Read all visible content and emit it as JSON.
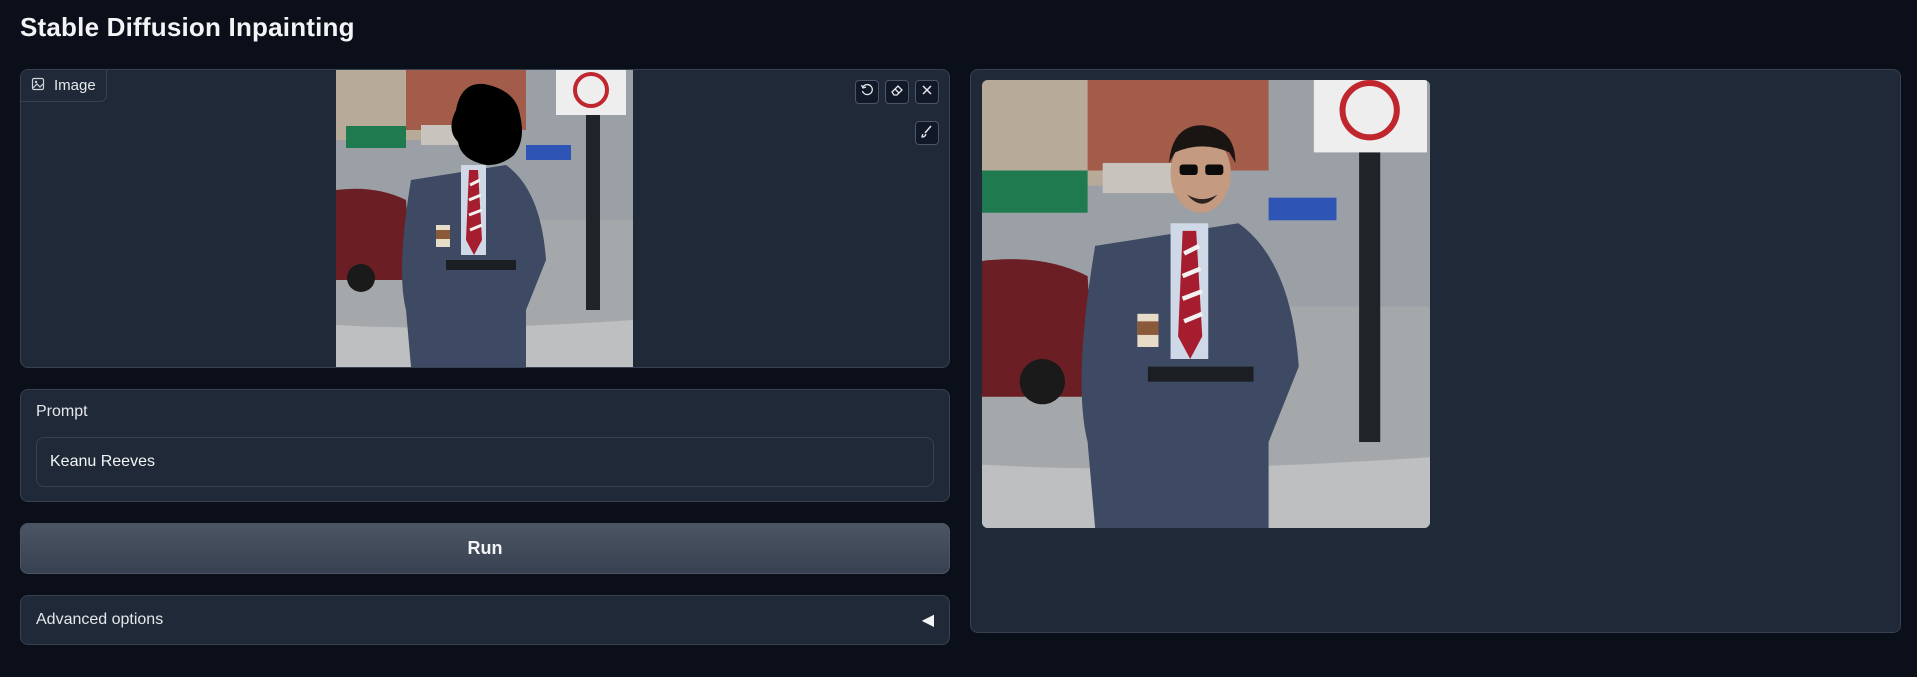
{
  "app": {
    "title": "Stable Diffusion Inpainting"
  },
  "image_input": {
    "label": "Image",
    "tools": [
      "undo-icon",
      "eraser-icon",
      "close-icon",
      "brush-icon"
    ]
  },
  "prompt": {
    "label": "Prompt",
    "value": "Keanu Reeves",
    "placeholder": ""
  },
  "run": {
    "label": "Run"
  },
  "advanced": {
    "label": "Advanced options",
    "caret": "◀"
  },
  "colors": {
    "background": "#0b0f19",
    "panel": "#1f2937",
    "border": "#374151",
    "button": "#4b5563"
  }
}
